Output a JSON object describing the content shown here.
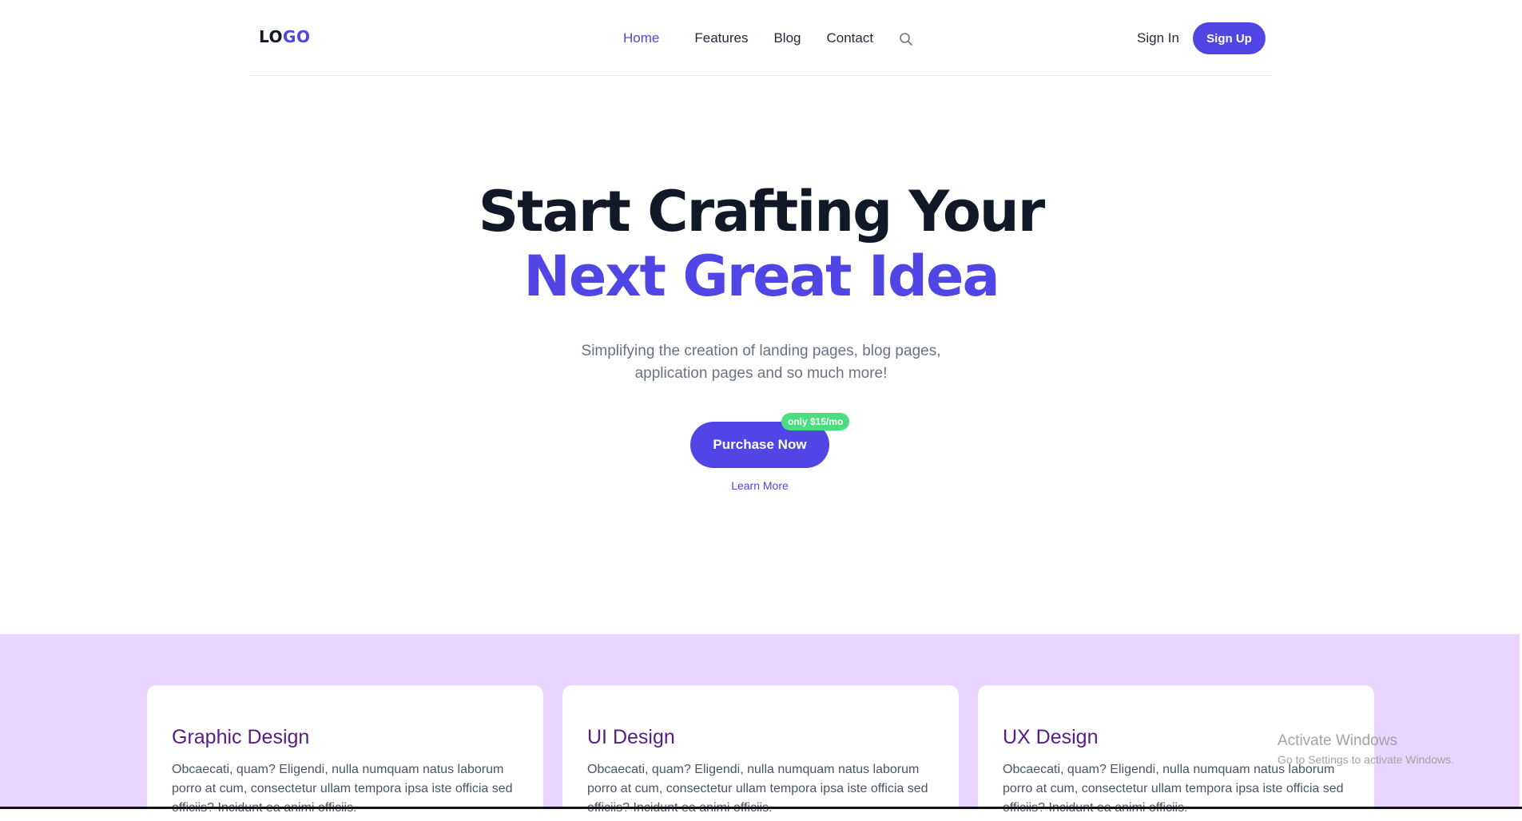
{
  "header": {
    "logo_part1": "LO",
    "logo_part2": "GO",
    "nav": [
      {
        "label": "Home",
        "active": true
      },
      {
        "label": "Features"
      },
      {
        "label": "Blog"
      },
      {
        "label": "Contact"
      }
    ],
    "search_icon": "search-icon",
    "signin_label": "Sign In",
    "signup_label": "Sign Up"
  },
  "hero": {
    "title_line1": "Start Crafting Your",
    "title_line2": "Next Great Idea",
    "subtitle_line1": "Simplifying the creation of landing pages, blog pages,",
    "subtitle_line2": "application pages and so much more!",
    "cta_label": "Purchase Now",
    "price_badge": "only $15/mo",
    "learn_more": "Learn More"
  },
  "features": [
    {
      "title": "Graphic Design",
      "text": "Obcaecati, quam? Eligendi, nulla numquam natus laborum porro at cum, consectetur ullam tempora ipsa iste officia sed officiis? Incidunt ea animi officiis."
    },
    {
      "title": "UI Design",
      "text": "Obcaecati, quam? Eligendi, nulla numquam natus laborum porro at cum, consectetur ullam tempora ipsa iste officia sed officiis? Incidunt ea animi officiis."
    },
    {
      "title": "UX Design",
      "text": "Obcaecati, quam? Eligendi, nulla numquam natus laborum porro at cum, consectetur ullam tempora ipsa iste officia sed officiis? Incidunt ea animi officiis."
    }
  ],
  "watermark": {
    "title": "Activate Windows",
    "subtitle": "Go to Settings to activate Windows."
  },
  "colors": {
    "accent": "#4f46e5",
    "badge": "#4ade80",
    "band": "#e9d5ff",
    "card_title": "#581c87"
  }
}
